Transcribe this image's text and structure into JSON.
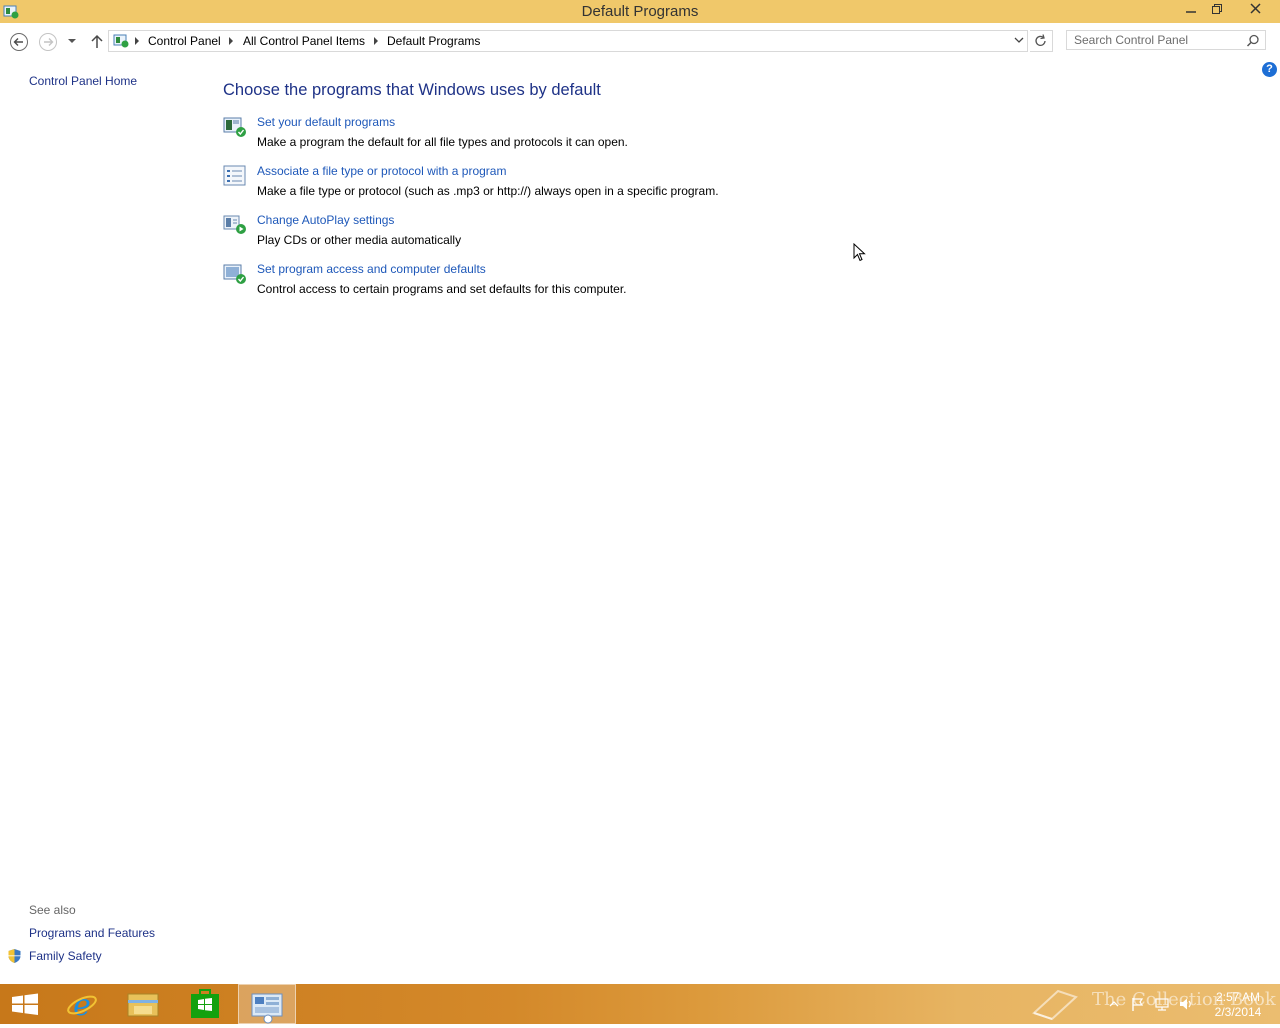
{
  "window": {
    "title": "Default Programs",
    "controls": {
      "minimize": "—",
      "maximize": "▢",
      "close": "✕"
    }
  },
  "navigation": {
    "breadcrumbs": [
      "Control Panel",
      "All Control Panel Items",
      "Default Programs"
    ],
    "search_placeholder": "Search Control Panel"
  },
  "left_pane": {
    "home_link": "Control Panel Home",
    "see_also_heading": "See also",
    "see_also_links": [
      "Programs and Features",
      "Family Safety"
    ]
  },
  "main": {
    "title": "Choose the programs that Windows uses by default",
    "tasks": [
      {
        "icon": "default-programs-icon",
        "link": "Set your default programs",
        "description": "Make a program the default for all file types and protocols it can open."
      },
      {
        "icon": "file-association-icon",
        "link": "Associate a file type or protocol with a program",
        "description": "Make a file type or protocol (such as .mp3 or http://) always open in a specific program."
      },
      {
        "icon": "autoplay-icon",
        "link": "Change AutoPlay settings",
        "description": "Play CDs or other media automatically"
      },
      {
        "icon": "program-access-icon",
        "link": "Set program access and computer defaults",
        "description": "Control access to certain programs and set defaults for this computer."
      }
    ]
  },
  "help": {
    "glyph": "?"
  },
  "taskbar": {
    "apps": [
      "start-icon",
      "internet-explorer-icon",
      "file-explorer-icon",
      "store-icon",
      "control-panel-icon"
    ],
    "clock": {
      "time": "2:57 AM",
      "date": "2/3/2014"
    },
    "watermark": "The Collection Book"
  },
  "colors": {
    "titlebar": "#f0c86a",
    "link": "#1e58b9",
    "heading": "#1e3287",
    "taskbar": "#d4892a"
  }
}
